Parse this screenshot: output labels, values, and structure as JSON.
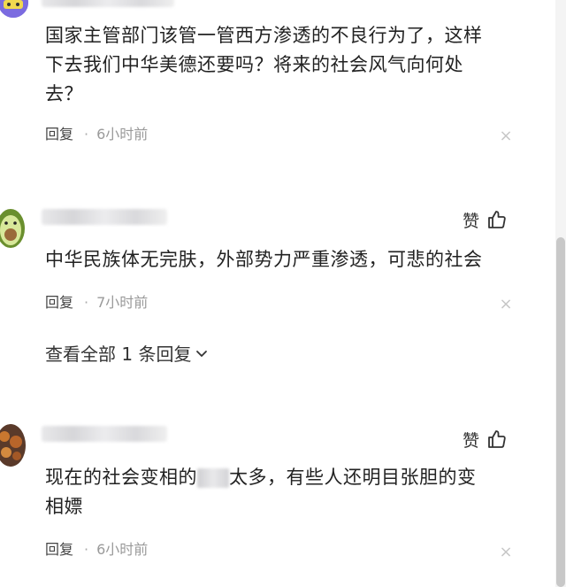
{
  "comments": [
    {
      "text_line1": "国家主管部门该管一管西方渗透的不良行为了，这样",
      "text_line2": "下去我们中华美德还要吗？将来的社会风气向何处",
      "text_line3": "去？",
      "reply_label": "回复",
      "separator": "·",
      "time": "6小时前",
      "close_glyph": "×"
    },
    {
      "like_label": "赞",
      "text_line1": "中华民族体无完肤，外部势力严重渗透，可悲的社会",
      "reply_label": "回复",
      "separator": "·",
      "time": "7小时前",
      "close_glyph": "×",
      "view_replies": "查看全部 1 条回复"
    },
    {
      "like_label": "赞",
      "text_line1_a": "现在的社会变相的",
      "text_line1_b": "太多，有些人还明目张胆的变",
      "text_line2": "相嫖",
      "reply_label": "回复",
      "separator": "·",
      "time": "6小时前",
      "close_glyph": "×"
    }
  ],
  "colors": {
    "text": "#222222",
    "meta_time": "#9a9a9a",
    "close": "#c7c7c7",
    "scroll_thumb": "#c8c8c8"
  },
  "icons": [
    "avatar-purple",
    "avatar-avocado",
    "avatar-food",
    "thumbs-up-icon",
    "chevron-down-icon",
    "close-icon"
  ]
}
